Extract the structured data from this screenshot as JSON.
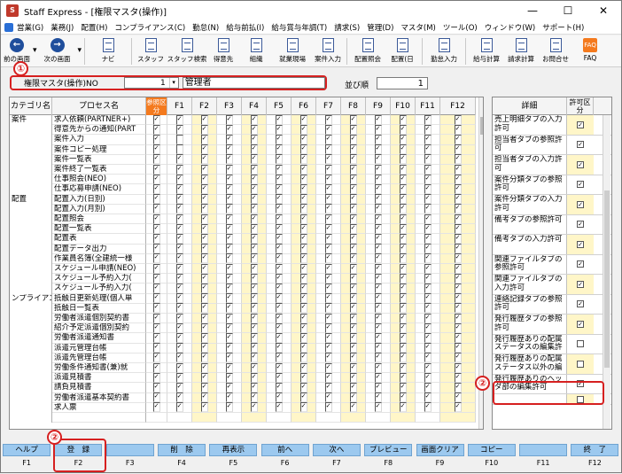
{
  "window": {
    "title": "Staff Express - [権限マスタ(操作)]",
    "min": "—",
    "max": "☐",
    "close": "✕"
  },
  "menu": [
    "営業(G)",
    "業務(J)",
    "配置(H)",
    "コンプライアンス(C)",
    "勤怠(N)",
    "給与前払(I)",
    "給与賞与年調(T)",
    "請求(S)",
    "管理(D)",
    "マスタ(M)",
    "ツール(O)",
    "ウィンドウ(W)",
    "サポート(H)"
  ],
  "toolbar": [
    {
      "label": "前の画面",
      "icon": "arrow-left-icon",
      "sym": "←",
      "drop": true
    },
    {
      "label": "次の画面",
      "icon": "arrow-right-icon",
      "sym": "→",
      "drop": true
    },
    {
      "label": "ナビ",
      "icon": "navi-icon"
    },
    {
      "label": "スタッフ",
      "icon": "staff-icon"
    },
    {
      "label": "スタッフ検索",
      "icon": "staff-search-icon"
    },
    {
      "label": "得意先",
      "icon": "client-icon"
    },
    {
      "label": "組織",
      "icon": "org-icon"
    },
    {
      "label": "就業現場",
      "icon": "workplace-icon"
    },
    {
      "label": "案件入力",
      "icon": "case-input-icon"
    },
    {
      "label": "配置照会",
      "icon": "placement-inquiry-icon"
    },
    {
      "label": "配置(日",
      "icon": "placement-day-icon"
    },
    {
      "label": "勤怠入力",
      "icon": "attendance-input-icon"
    },
    {
      "label": "給与計算",
      "icon": "payroll-icon"
    },
    {
      "label": "請求計算",
      "icon": "billing-icon"
    },
    {
      "label": "お問合せ",
      "icon": "inquiry-icon"
    },
    {
      "label": "FAQ",
      "icon": "faq-icon"
    }
  ],
  "header": {
    "label": "権限マスタ(操作)NO",
    "no": "1",
    "name": "管理者",
    "order_label": "並び順",
    "order": "1",
    "badge1": "①",
    "badge2": "②"
  },
  "grid": {
    "columns": [
      "カテゴリ名",
      "プロセス名",
      "参照区分",
      "F1",
      "F2",
      "F3",
      "F4",
      "F5",
      "F6",
      "F7",
      "F8",
      "F9",
      "F10",
      "F11",
      "F12"
    ],
    "rows": [
      {
        "cat": "案件",
        "proc": "求人依頼(PARTNER+)"
      },
      {
        "cat": "",
        "proc": "得意先からの通知(PART"
      },
      {
        "cat": "",
        "proc": "案件入力"
      },
      {
        "cat": "",
        "proc": "案件コピー処理"
      },
      {
        "cat": "",
        "proc": "案件一覧表"
      },
      {
        "cat": "",
        "proc": "案件終了一覧表"
      },
      {
        "cat": "",
        "proc": "仕事照会(NEO)"
      },
      {
        "cat": "",
        "proc": "仕事応募申請(NEO)"
      },
      {
        "cat": "配置",
        "proc": "配置入力(日別)"
      },
      {
        "cat": "",
        "proc": "配置入力(月別)"
      },
      {
        "cat": "",
        "proc": "配置照会"
      },
      {
        "cat": "",
        "proc": "配置一覧表"
      },
      {
        "cat": "",
        "proc": "配置表"
      },
      {
        "cat": "",
        "proc": "配置データ出力"
      },
      {
        "cat": "",
        "proc": "作業員名簿(全建統一様"
      },
      {
        "cat": "",
        "proc": "スケジュール申請(NEO)"
      },
      {
        "cat": "",
        "proc": "スケジュール予約入力("
      },
      {
        "cat": "",
        "proc": "スケジュール予約入力("
      },
      {
        "cat": "ンプライアン",
        "proc": "抵触日更新処理(個人単"
      },
      {
        "cat": "",
        "proc": "抵触日一覧表"
      },
      {
        "cat": "",
        "proc": "労働者派遣個別契約書"
      },
      {
        "cat": "",
        "proc": "紹介予定派遣個別契約"
      },
      {
        "cat": "",
        "proc": "労働者派遣通知書"
      },
      {
        "cat": "",
        "proc": "派遣元管理台帳"
      },
      {
        "cat": "",
        "proc": "派遣先管理台帳"
      },
      {
        "cat": "",
        "proc": "労働条件通知書(兼)就"
      },
      {
        "cat": "",
        "proc": "派遣見積書"
      },
      {
        "cat": "",
        "proc": "請負見積書"
      },
      {
        "cat": "",
        "proc": "労働者派遣基本契約書"
      },
      {
        "cat": "",
        "proc": "求人票"
      },
      {
        "cat": "",
        "proc": ""
      }
    ]
  },
  "detail": {
    "col_title": "詳細",
    "col_perm": "許可区分",
    "rows": [
      {
        "text": "売上明細タブの入力許可",
        "checked": true
      },
      {
        "text": "担当者タブの参照許可",
        "checked": true
      },
      {
        "text": "担当者タブの入力許可",
        "checked": true
      },
      {
        "text": "案件分類タブの参照許可",
        "checked": true
      },
      {
        "text": "案件分類タブの入力許可",
        "checked": true
      },
      {
        "text": "備考タブの参照許可",
        "checked": true
      },
      {
        "text": "備考タブの入力許可",
        "checked": true
      },
      {
        "text": "関連ファイルタブの参照許可",
        "checked": true
      },
      {
        "text": "関連ファイルタブの入力許可",
        "checked": true
      },
      {
        "text": "連絡記録タブの参照許可",
        "checked": true
      },
      {
        "text": "発行履歴タブの参照許可",
        "checked": true
      },
      {
        "text": "発行履歴ありの配属ステータスの編集許",
        "checked": false
      },
      {
        "text": "発行履歴ありの配属ステータス以外の編",
        "checked": false
      },
      {
        "text": "発行履歴ありのヘッダ部の編集許可",
        "checked": true
      },
      {
        "text": "",
        "checked": false
      }
    ]
  },
  "fkeys": [
    {
      "label": "ヘルプ",
      "key": "F1"
    },
    {
      "label": "登　録",
      "key": "F2"
    },
    {
      "label": "",
      "key": "F3"
    },
    {
      "label": "削　除",
      "key": "F4"
    },
    {
      "label": "再表示",
      "key": "F5"
    },
    {
      "label": "前へ",
      "key": "F6"
    },
    {
      "label": "次へ",
      "key": "F7"
    },
    {
      "label": "プレビュー",
      "key": "F8"
    },
    {
      "label": "画面クリア",
      "key": "F9"
    },
    {
      "label": "コピー",
      "key": "F10"
    },
    {
      "label": "",
      "key": "F11"
    },
    {
      "label": "終　了",
      "key": "F12"
    }
  ]
}
